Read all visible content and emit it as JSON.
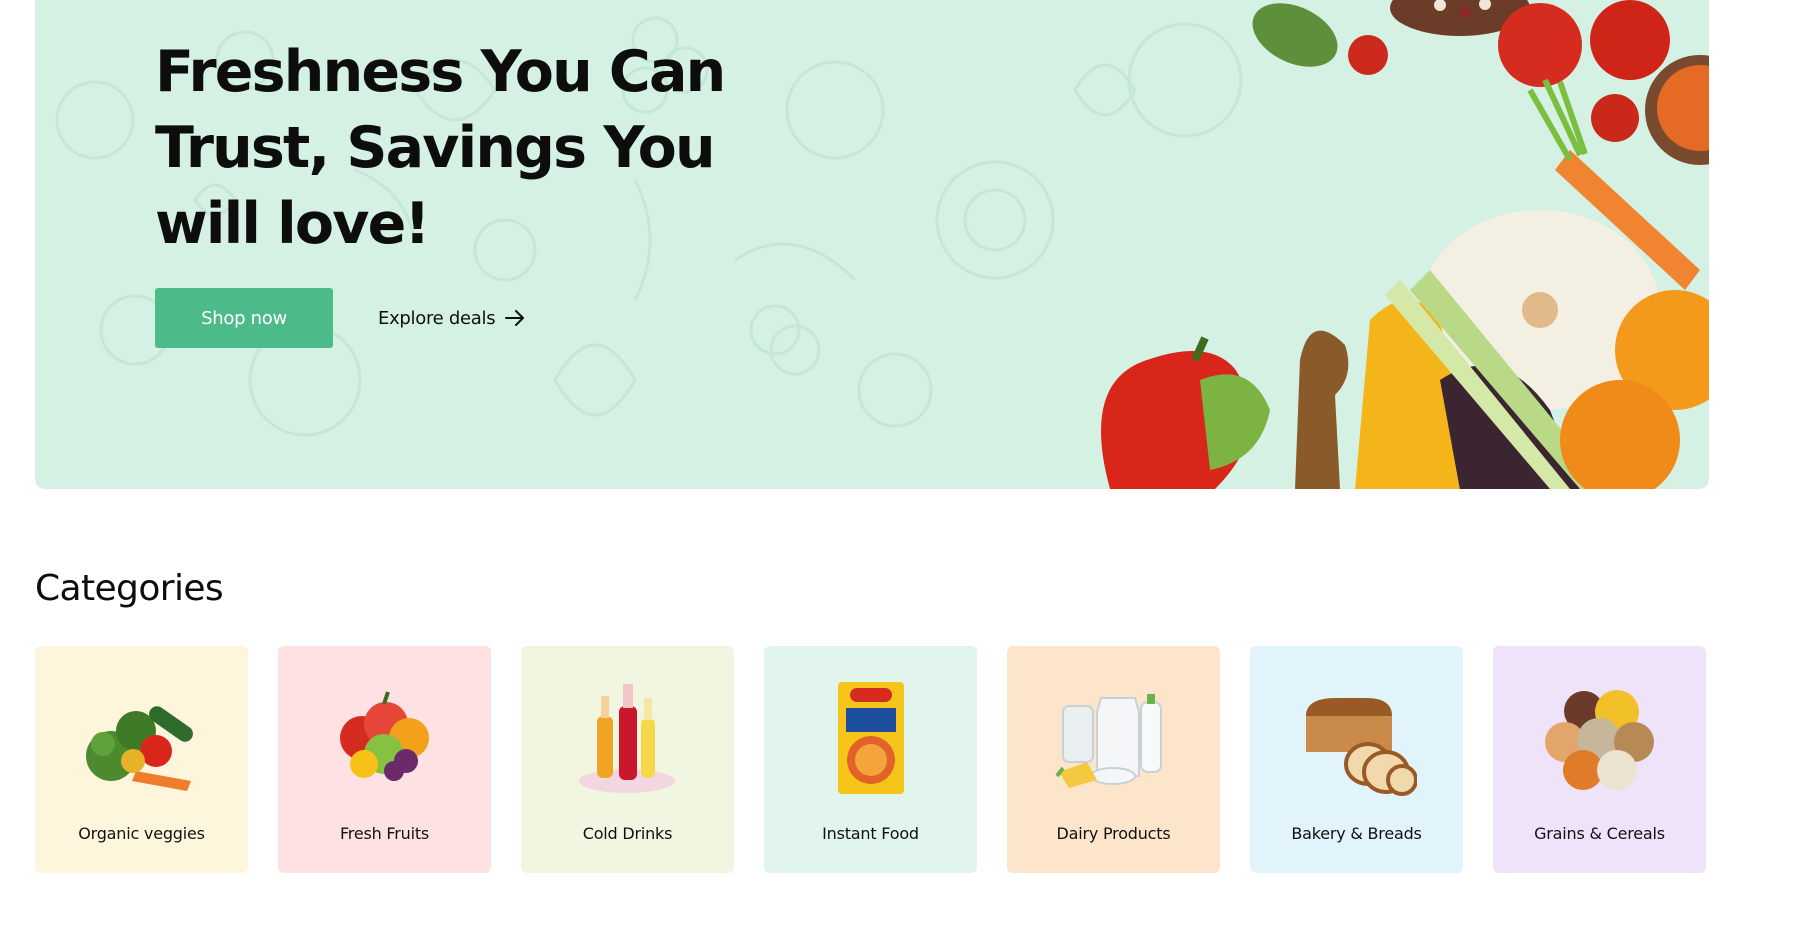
{
  "hero": {
    "title": "Freshness You Can Trust, Savings You will love!",
    "shop_button_label": "Shop now",
    "explore_link_label": "Explore deals",
    "background_color": "#d4f1e3",
    "button_color": "#4cbb89",
    "explore_icon": "arrow-right-icon"
  },
  "categories": {
    "title": "Categories",
    "items": [
      {
        "label": "Organic veggies",
        "background": "#fdf5dc",
        "icon": "vegetables-icon"
      },
      {
        "label": "Fresh Fruits",
        "background": "#fde1e3",
        "icon": "fruits-icon"
      },
      {
        "label": "Cold Drinks",
        "background": "#f0f6e0",
        "icon": "drinks-icon"
      },
      {
        "label": "Instant Food",
        "background": "#e2f5ec",
        "icon": "noodles-packet-icon"
      },
      {
        "label": "Dairy Products",
        "background": "#fde5cc",
        "icon": "dairy-icon"
      },
      {
        "label": "Bakery & Breads",
        "background": "#e2f4fb",
        "icon": "bread-icon"
      },
      {
        "label": "Grains & Cereals",
        "background": "#efe3f9",
        "icon": "grains-icon"
      }
    ]
  }
}
